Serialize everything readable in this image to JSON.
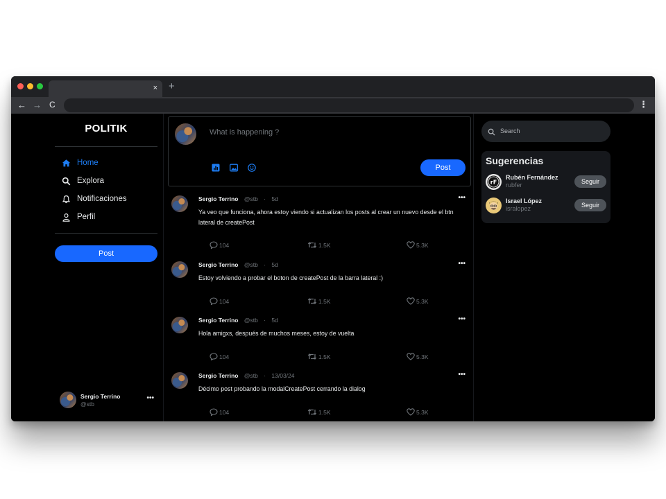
{
  "browser": {
    "tab_close": "×",
    "new_tab": "+",
    "back": "←",
    "forward": "→",
    "reload": "C",
    "menu": "⋮"
  },
  "sidebar": {
    "logo": "POLITIK",
    "items": [
      {
        "label": "Home",
        "icon": "home-icon",
        "active": true
      },
      {
        "label": "Explora",
        "icon": "search-icon",
        "active": false
      },
      {
        "label": "Notificaciones",
        "icon": "bell-icon",
        "active": false
      },
      {
        "label": "Perfil",
        "icon": "user-icon",
        "active": false
      }
    ],
    "post_button": "Post",
    "profile": {
      "name": "Sergio Terrino",
      "handle": "@stb",
      "more": "•••"
    }
  },
  "composer": {
    "placeholder": "What is happening ?",
    "post_button": "Post",
    "tools": [
      "chart-icon",
      "image-icon",
      "emoji-icon"
    ]
  },
  "posts": [
    {
      "author": "Sergio Terrino",
      "handle": "@stb",
      "sep": "·",
      "time": "5d",
      "more": "•••",
      "text": "Ya veo que funciona, ahora estoy viendo si actualizan los posts al crear un nuevo desde el btn lateral de createPost",
      "replies": "104",
      "reposts": "1.5K",
      "likes": "5.3K"
    },
    {
      "author": "Sergio Terrino",
      "handle": "@stb",
      "sep": "·",
      "time": "5d",
      "more": "•••",
      "text": "Estoy volviendo a probar el boton de createPost de la barra lateral :)",
      "replies": "104",
      "reposts": "1.5K",
      "likes": "5.3K"
    },
    {
      "author": "Sergio Terrino",
      "handle": "@stb",
      "sep": "·",
      "time": "5d",
      "more": "•••",
      "text": "Hola amigxs, después de muchos meses, estoy de vuelta",
      "replies": "104",
      "reposts": "1.5K",
      "likes": "5.3K"
    },
    {
      "author": "Sergio Terrino",
      "handle": "@stb",
      "sep": "·",
      "time": "13/03/24",
      "more": "•••",
      "text": "Décimo post probando la modalCreatePost cerrando la dialog",
      "replies": "104",
      "reposts": "1.5K",
      "likes": "5.3K"
    }
  ],
  "search": {
    "placeholder": "Search"
  },
  "suggestions": {
    "title": "Sugerencias",
    "users": [
      {
        "name": "Rubén Fernández",
        "handle": "rubfer",
        "button": "Seguir"
      },
      {
        "name": "Israel López",
        "handle": "isralopez",
        "button": "Seguir"
      }
    ]
  },
  "colors": {
    "accent": "#1868ff",
    "active_nav": "#1d7cf2",
    "background": "#000000",
    "muted_text": "#71767b"
  }
}
